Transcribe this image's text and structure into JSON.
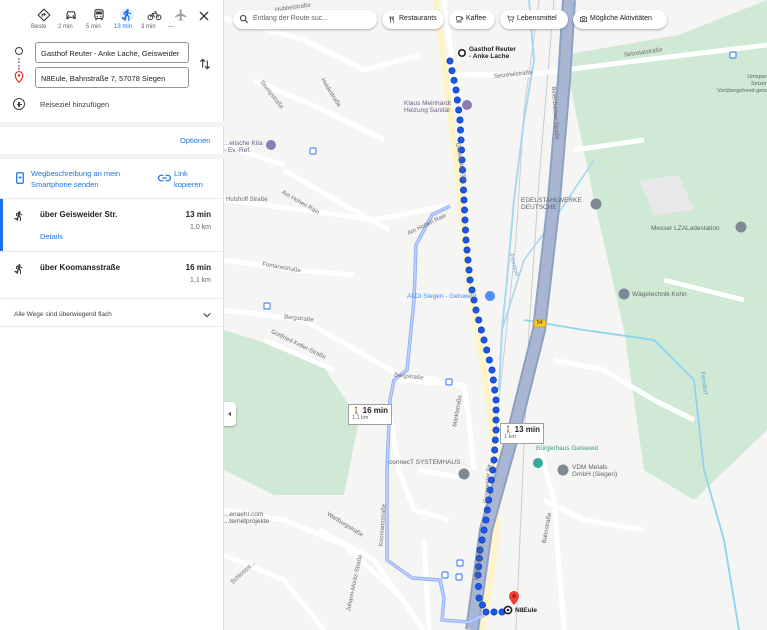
{
  "modes": [
    {
      "name": "mode-best",
      "label": "Beste",
      "active": false
    },
    {
      "name": "mode-car",
      "label": "2 min",
      "active": false
    },
    {
      "name": "mode-transit",
      "label": "5 min",
      "active": false
    },
    {
      "name": "mode-walk",
      "label": "13 min",
      "active": true
    },
    {
      "name": "mode-bike",
      "label": "3 min",
      "active": false
    },
    {
      "name": "mode-flight",
      "label": "—",
      "active": false
    }
  ],
  "origin": "Gasthof Reuter - Anke Lache, Geisweider",
  "destination": "N8Eule, Bahnstraße 7, 57078 Siegen",
  "add_destination": "Reiseziel hinzufügen",
  "options": "Optionen",
  "send_to_phone": "Wegbeschreibung an mein Smartphone senden",
  "copy_link": "Link kopieren",
  "routes": [
    {
      "title": "über Geisweider Str.",
      "duration": "13 min",
      "distance": "1,0 km",
      "details": "Details",
      "selected": true
    },
    {
      "title": "über Koomansstraße",
      "duration": "16 min",
      "distance": "1,1 km",
      "selected": false
    }
  ],
  "all_routes_note": "Alle Wege sind überwiegend flach",
  "map": {
    "search_placeholder": "Entlang der Route suc...",
    "chips": [
      "Restaurants",
      "Kaffee",
      "Lebensmittel",
      "Mögliche Aktivitäten"
    ],
    "start_label": "Gasthof Reuter\n- Anke Lache",
    "end_label": "N8Eule",
    "route_main_box": {
      "duration": "13 min",
      "distance": "1 km"
    },
    "route_alt_box": {
      "duration": "16 min",
      "distance": "1,1 km"
    },
    "streets": {
      "hubbelstrasse": "Hubbelstraße",
      "setzetalstrasse_1": "Setzetalstraße",
      "setzetalstrasse_2": "Setzetalstraße",
      "stornystrasse": "Stornystraße",
      "heidestrasse": "Heidestraße",
      "geisweider_str_1": "Geisweider Str.",
      "geisweider_str_2": "Geisweider Str.",
      "am_hohen_rain_1": "Am Hohen Rain",
      "am_hohen_rain_2": "Am Hohen Rain",
      "hulshoffstrasse": "Hulshoff Straße",
      "fontanestrasse": "Fontanestraße",
      "bergstrasse_1": "Bergstraße",
      "bergstrasse_2": "Bergstraße",
      "gottfried_keller": "Gottfried-Keller-Straße",
      "marktstrasse": "Marktstraße",
      "koomansstrasse": "Koomansstraße",
      "wartburgstrasse": "Wartburgstraße",
      "schloss": "Schlossst...",
      "johann_moritz": "Johann-Moritz-Straße",
      "rundstrasse": "Hüttenstraße",
      "bahnstrasse": "Bahnstraße",
      "b54": "54",
      "ferndorf_1": "Ferndorf",
      "ferndorf_2": "Ferndorf",
      "bundesstrasse": "Birlenbacher Straße"
    },
    "pois": {
      "klaus": "Klaus Meinhardt\nHeizung Sanitär",
      "kita": "...elische Kita\n- Ev.-Ref.",
      "edelstahl": "EDELSTAHLWERKE\nDEUTSCHE",
      "messer": "Messer LZALadestation",
      "aldi": "ALDI Siegen - Geisweid",
      "waegetechnik": "Wägetechnik Kohn",
      "connect": "connecT SYSTEMHAUS",
      "burgerhaus": "Bürgerhaus Geisweid",
      "vdm": "VDM Metals\nGmbH (Siegen)",
      "umspannwerk": "Umspannwe\nSetzer Wie\nVorübergehend geschlos",
      "sehr": "...enaehr.com\n...ternetprojekte"
    }
  }
}
